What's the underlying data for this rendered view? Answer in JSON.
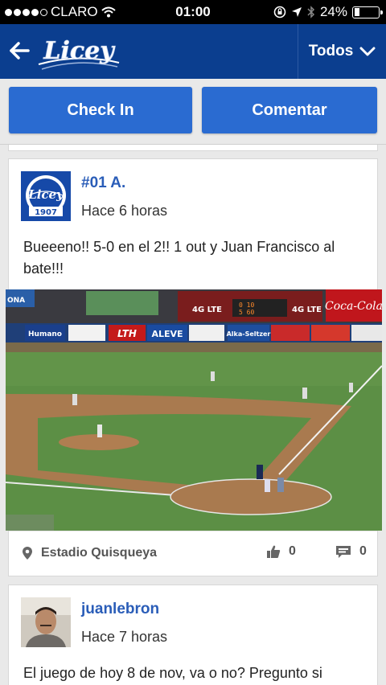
{
  "status_bar": {
    "carrier": "CLARO",
    "time": "01:00",
    "battery": "24%",
    "battery_level": 0.24,
    "icons": [
      "signal-dots",
      "wifi-icon",
      "lock-rotation-icon",
      "location-arrow-icon",
      "bluetooth-icon",
      "battery-icon"
    ]
  },
  "nav": {
    "logo_text": "Licey",
    "filter_label": "Todos",
    "colors": {
      "bar": "#0b3e8f",
      "accent": "#2a6bd1"
    }
  },
  "actions": {
    "checkin_label": "Check In",
    "comment_label": "Comentar"
  },
  "posts": [
    {
      "username": "#01 A.",
      "time": "Hace 6 horas",
      "avatar": "licey-logo-avatar",
      "avatar_year": "1907",
      "text": "Bueeeno!! 5-0 en el 2!! 1 out y Juan Francisco al bate!!!",
      "photo": {
        "description": "baseball-stadium-photo",
        "signs": [
          "Coca-Cola",
          "Humano",
          "LTH",
          "ALEVE",
          "Alka-Seltzer",
          "4G LTE",
          "ONA"
        ]
      },
      "location": "Estadio Quisqueya",
      "likes": "0",
      "comments": "0"
    },
    {
      "username": "juanlebron",
      "time": "Hace 7 horas",
      "avatar": "user-photo-avatar",
      "text": "El juego de hoy 8 de nov, va o no? Pregunto si"
    }
  ]
}
